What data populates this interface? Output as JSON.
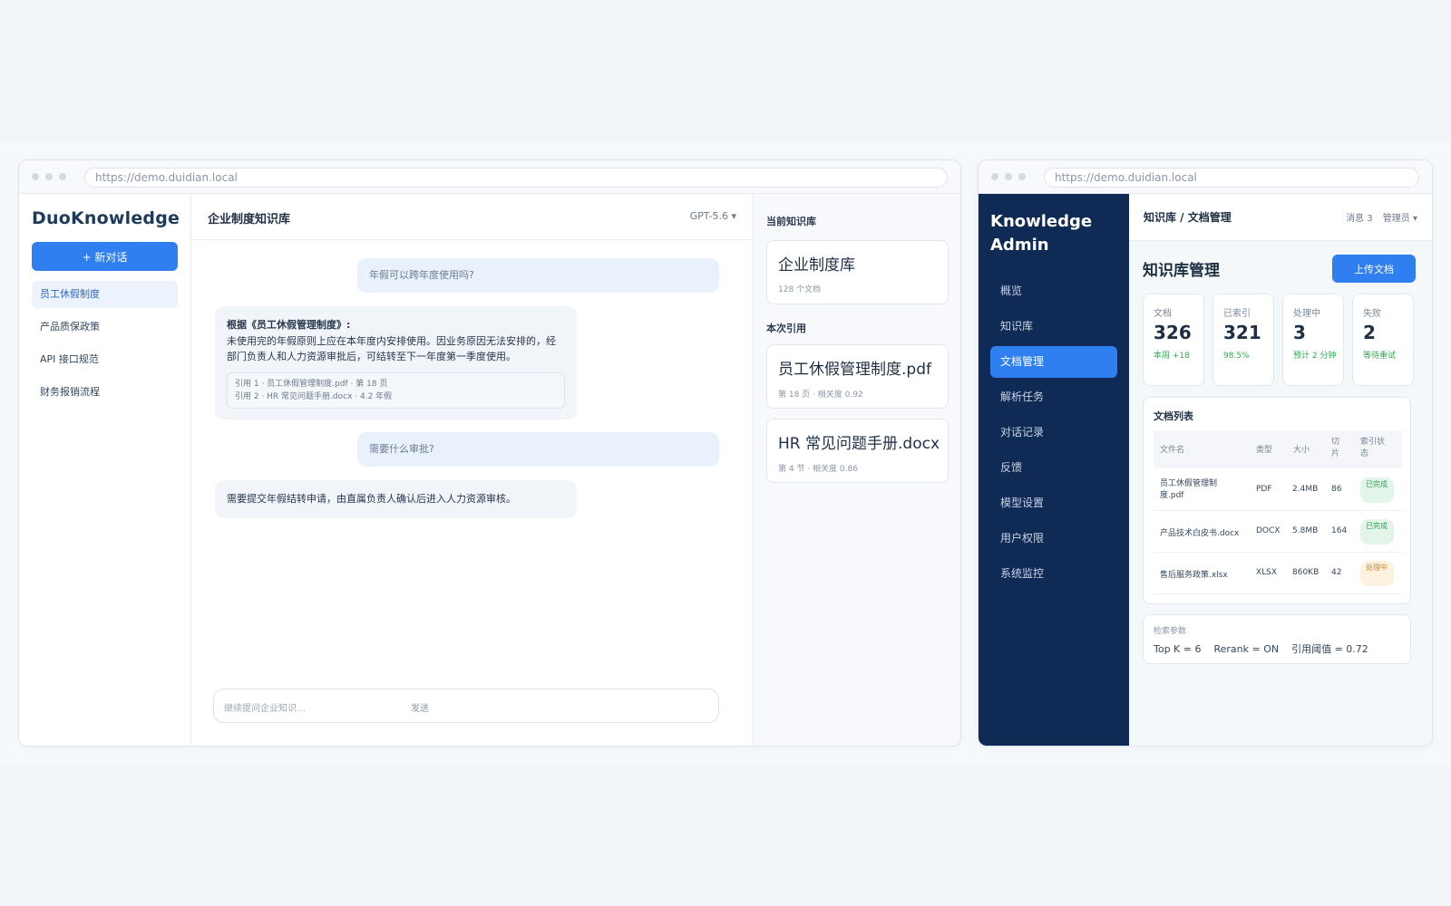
{
  "chat_window": {
    "url": "https://demo.duidian.local",
    "logo": "DuoKnowledge",
    "new_chat_label": "+ 新对话",
    "conversations": [
      "员工休假制度",
      "产品质保政策",
      "API 接口规范",
      "财务报销流程"
    ],
    "active_conversation_index": 0,
    "header_title": "企业制度知识库",
    "model_label": "GPT-5.6 ▾",
    "messages": {
      "user_1": "年假可以跨年度使用吗?",
      "ai_1_title": "根据《员工休假管理制度》:",
      "ai_1_body": "未使用完的年假原则上应在本年度内安排使用。因业务原因无法安排的，经部门负责人和人力资源审批后，可结转至下一年度第一季度使用。",
      "ai_1_cite_1": "引用 1 · 员工休假管理制度.pdf · 第 18 页",
      "ai_1_cite_2": "引用 2 · HR 常见问题手册.docx · 4.2 年假",
      "user_2": "需要什么审批?",
      "ai_2_body": "需要提交年假结转申请，由直属负责人确认后进入人力资源审核。"
    },
    "input_placeholder": "继续提问企业知识…",
    "send_label": "发送",
    "ref_panel": {
      "current_kb_label": "当前知识库",
      "kb_name": "企业制度库",
      "kb_meta": "128 个文档",
      "citations_label": "本次引用",
      "citations": [
        {
          "title": "员工休假管理制度.pdf",
          "meta": "第 18 页 · 相关度 0.92"
        },
        {
          "title": "HR 常见问题手册.docx",
          "meta": "第 4 节 · 相关度 0.86"
        }
      ]
    }
  },
  "admin_window": {
    "url": "https://demo.duidian.local",
    "logo_line1": "Knowledge",
    "logo_line2": "Admin",
    "nav": [
      "概览",
      "知识库",
      "文档管理",
      "解析任务",
      "对话记录",
      "反馈",
      "模型设置",
      "用户权限",
      "系统监控"
    ],
    "active_nav_index": 2,
    "breadcrumb": "知识库 / 文档管理",
    "messages_label": "消息 3",
    "user_label": "管理员 ▾",
    "page_title": "知识库管理",
    "upload_label": "上传文档",
    "stats": [
      {
        "label": "文档",
        "value": "326",
        "sub": "本周 +18"
      },
      {
        "label": "已索引",
        "value": "321",
        "sub": "98.5%"
      },
      {
        "label": "处理中",
        "value": "3",
        "sub": "预计 2 分钟"
      },
      {
        "label": "失败",
        "value": "2",
        "sub": "等待重试"
      }
    ],
    "doc_list": {
      "title": "文档列表",
      "columns": [
        "文件名",
        "类型",
        "大小",
        "切片",
        "索引状态"
      ],
      "rows": [
        {
          "name": "员工休假管理制度.pdf",
          "type": "PDF",
          "size": "2.4MB",
          "chunks": "86",
          "status": "已完成",
          "status_kind": "done"
        },
        {
          "name": "产品技术白皮书.docx",
          "type": "DOCX",
          "size": "5.8MB",
          "chunks": "164",
          "status": "已完成",
          "status_kind": "done"
        },
        {
          "name": "售后服务政策.xlsx",
          "type": "XLSX",
          "size": "860KB",
          "chunks": "42",
          "status": "处理中",
          "status_kind": "processing"
        }
      ]
    },
    "params": {
      "label": "检索参数",
      "values": "Top K = 6    Rerank = ON    引用阈值 = 0.72"
    }
  },
  "colors": {
    "accent": "#2f7ff0",
    "admin_sidebar": "#0f2a54",
    "success": "#34a853",
    "warning": "#d1852a"
  }
}
